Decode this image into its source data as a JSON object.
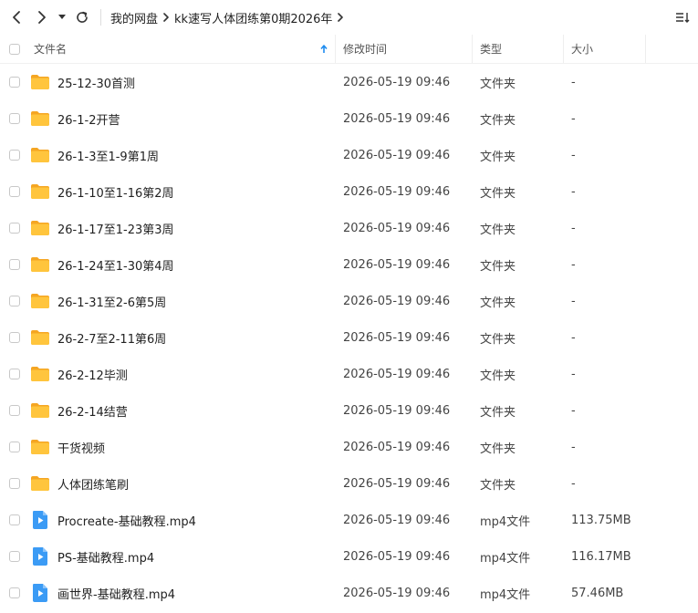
{
  "toolbar": {
    "breadcrumb": [
      {
        "label": "我的网盘"
      },
      {
        "label": "kk速写人体团练第0期2026年"
      }
    ]
  },
  "header": {
    "name": "文件名",
    "time": "修改时间",
    "type": "类型",
    "size": "大小"
  },
  "rows": [
    {
      "name": "25-12-30首测",
      "time": "2026-05-19 09:46",
      "type": "文件夹",
      "size": "-",
      "kind": "folder"
    },
    {
      "name": "26-1-2开营",
      "time": "2026-05-19 09:46",
      "type": "文件夹",
      "size": "-",
      "kind": "folder"
    },
    {
      "name": "26-1-3至1-9第1周",
      "time": "2026-05-19 09:46",
      "type": "文件夹",
      "size": "-",
      "kind": "folder"
    },
    {
      "name": "26-1-10至1-16第2周",
      "time": "2026-05-19 09:46",
      "type": "文件夹",
      "size": "-",
      "kind": "folder"
    },
    {
      "name": "26-1-17至1-23第3周",
      "time": "2026-05-19 09:46",
      "type": "文件夹",
      "size": "-",
      "kind": "folder"
    },
    {
      "name": "26-1-24至1-30第4周",
      "time": "2026-05-19 09:46",
      "type": "文件夹",
      "size": "-",
      "kind": "folder"
    },
    {
      "name": "26-1-31至2-6第5周",
      "time": "2026-05-19 09:46",
      "type": "文件夹",
      "size": "-",
      "kind": "folder"
    },
    {
      "name": "26-2-7至2-11第6周",
      "time": "2026-05-19 09:46",
      "type": "文件夹",
      "size": "-",
      "kind": "folder"
    },
    {
      "name": "26-2-12毕测",
      "time": "2026-05-19 09:46",
      "type": "文件夹",
      "size": "-",
      "kind": "folder"
    },
    {
      "name": "26-2-14结营",
      "time": "2026-05-19 09:46",
      "type": "文件夹",
      "size": "-",
      "kind": "folder"
    },
    {
      "name": "干货视频",
      "time": "2026-05-19 09:46",
      "type": "文件夹",
      "size": "-",
      "kind": "folder"
    },
    {
      "name": "人体团练笔刷",
      "time": "2026-05-19 09:46",
      "type": "文件夹",
      "size": "-",
      "kind": "folder"
    },
    {
      "name": "Procreate-基础教程.mp4",
      "time": "2026-05-19 09:46",
      "type": "mp4文件",
      "size": "113.75MB",
      "kind": "video"
    },
    {
      "name": "PS-基础教程.mp4",
      "time": "2026-05-19 09:46",
      "type": "mp4文件",
      "size": "116.17MB",
      "kind": "video"
    },
    {
      "name": "画世界-基础教程.mp4",
      "time": "2026-05-19 09:46",
      "type": "mp4文件",
      "size": "57.46MB",
      "kind": "video"
    }
  ],
  "icons": {
    "folder": "folder-icon",
    "video": "video-file-icon"
  },
  "colors": {
    "folder": "#FFC53D",
    "folder_tab": "#F5A623",
    "video": "#3B9BF5",
    "sort_arrow": "#1E8CF0"
  }
}
